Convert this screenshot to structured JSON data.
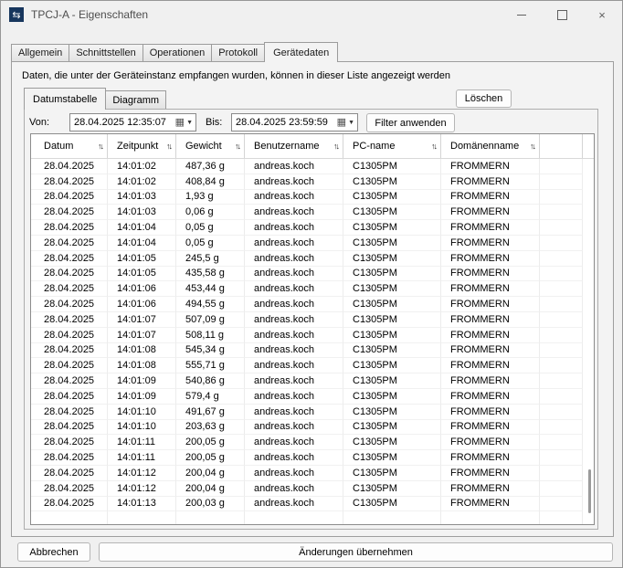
{
  "window": {
    "title": "TPCJ-A - Eigenschaften"
  },
  "tabs": {
    "items": [
      {
        "label": "Allgemein"
      },
      {
        "label": "Schnittstellen"
      },
      {
        "label": "Operationen"
      },
      {
        "label": "Protokoll"
      },
      {
        "label": "Gerätedaten"
      }
    ],
    "active": "Gerätedaten"
  },
  "panel": {
    "description": "Daten, die unter der Geräteinstanz empfangen wurden, können in dieser Liste angezeigt werden",
    "delete_button": "Löschen",
    "subtabs": {
      "items": [
        {
          "label": "Datumstabelle"
        },
        {
          "label": "Diagramm"
        }
      ],
      "active": "Datumstabelle"
    }
  },
  "filter": {
    "von_label": "Von:",
    "von_value": "28.04.2025 12:35:07",
    "bis_label": "Bis:",
    "bis_value": "28.04.2025 23:59:59",
    "apply_button": "Filter anwenden",
    "calendar_icon": "▦",
    "dropdown_icon": "▼"
  },
  "table": {
    "columns": [
      "Datum",
      "Zeitpunkt",
      "Gewicht",
      "Benutzername",
      "PC-name",
      "Domänenname"
    ],
    "sort_icon": "↑↓",
    "rows": [
      [
        "28.04.2025",
        "14:01:02",
        "487,36 g",
        "andreas.koch",
        "C1305PM",
        "FROMMERN"
      ],
      [
        "28.04.2025",
        "14:01:02",
        "408,84 g",
        "andreas.koch",
        "C1305PM",
        "FROMMERN"
      ],
      [
        "28.04.2025",
        "14:01:03",
        "1,93 g",
        "andreas.koch",
        "C1305PM",
        "FROMMERN"
      ],
      [
        "28.04.2025",
        "14:01:03",
        "0,06 g",
        "andreas.koch",
        "C1305PM",
        "FROMMERN"
      ],
      [
        "28.04.2025",
        "14:01:04",
        "0,05 g",
        "andreas.koch",
        "C1305PM",
        "FROMMERN"
      ],
      [
        "28.04.2025",
        "14:01:04",
        "0,05 g",
        "andreas.koch",
        "C1305PM",
        "FROMMERN"
      ],
      [
        "28.04.2025",
        "14:01:05",
        "245,5 g",
        "andreas.koch",
        "C1305PM",
        "FROMMERN"
      ],
      [
        "28.04.2025",
        "14:01:05",
        "435,58 g",
        "andreas.koch",
        "C1305PM",
        "FROMMERN"
      ],
      [
        "28.04.2025",
        "14:01:06",
        "453,44 g",
        "andreas.koch",
        "C1305PM",
        "FROMMERN"
      ],
      [
        "28.04.2025",
        "14:01:06",
        "494,55 g",
        "andreas.koch",
        "C1305PM",
        "FROMMERN"
      ],
      [
        "28.04.2025",
        "14:01:07",
        "507,09 g",
        "andreas.koch",
        "C1305PM",
        "FROMMERN"
      ],
      [
        "28.04.2025",
        "14:01:07",
        "508,11 g",
        "andreas.koch",
        "C1305PM",
        "FROMMERN"
      ],
      [
        "28.04.2025",
        "14:01:08",
        "545,34 g",
        "andreas.koch",
        "C1305PM",
        "FROMMERN"
      ],
      [
        "28.04.2025",
        "14:01:08",
        "555,71 g",
        "andreas.koch",
        "C1305PM",
        "FROMMERN"
      ],
      [
        "28.04.2025",
        "14:01:09",
        "540,86 g",
        "andreas.koch",
        "C1305PM",
        "FROMMERN"
      ],
      [
        "28.04.2025",
        "14:01:09",
        "579,4 g",
        "andreas.koch",
        "C1305PM",
        "FROMMERN"
      ],
      [
        "28.04.2025",
        "14:01:10",
        "491,67 g",
        "andreas.koch",
        "C1305PM",
        "FROMMERN"
      ],
      [
        "28.04.2025",
        "14:01:10",
        "203,63 g",
        "andreas.koch",
        "C1305PM",
        "FROMMERN"
      ],
      [
        "28.04.2025",
        "14:01:11",
        "200,05 g",
        "andreas.koch",
        "C1305PM",
        "FROMMERN"
      ],
      [
        "28.04.2025",
        "14:01:11",
        "200,05 g",
        "andreas.koch",
        "C1305PM",
        "FROMMERN"
      ],
      [
        "28.04.2025",
        "14:01:12",
        "200,04 g",
        "andreas.koch",
        "C1305PM",
        "FROMMERN"
      ],
      [
        "28.04.2025",
        "14:01:12",
        "200,04 g",
        "andreas.koch",
        "C1305PM",
        "FROMMERN"
      ],
      [
        "28.04.2025",
        "14:01:13",
        "200,03 g",
        "andreas.koch",
        "C1305PM",
        "FROMMERN"
      ]
    ]
  },
  "footer": {
    "cancel_button": "Abbrechen",
    "apply_button": "Änderungen übernehmen"
  }
}
